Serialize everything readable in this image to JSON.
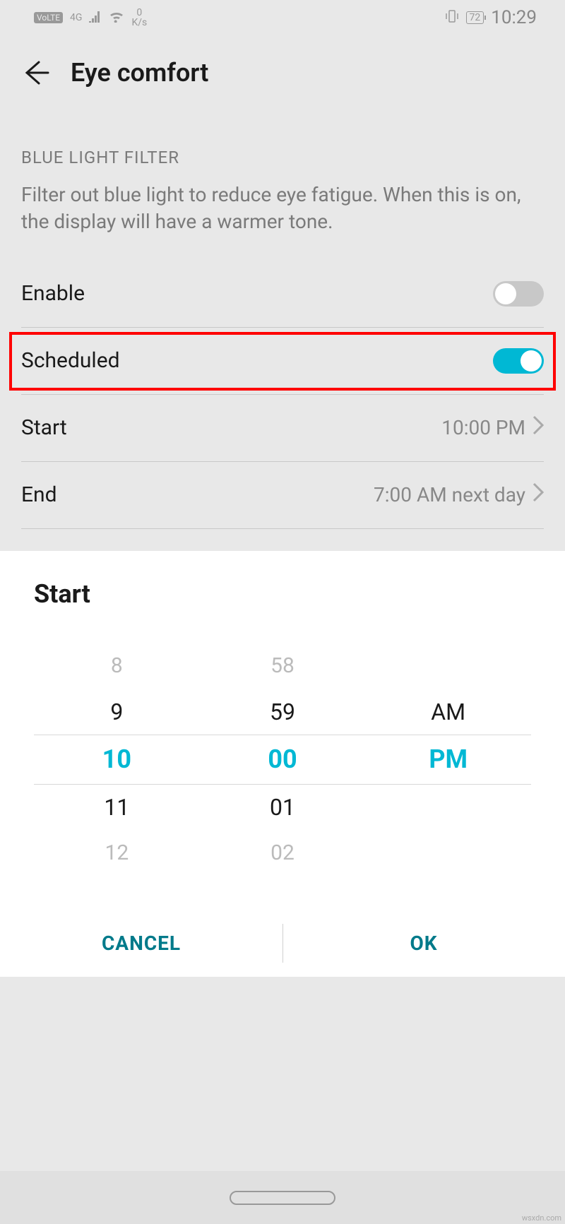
{
  "statusbar": {
    "volte": "VoLTE",
    "network": "4G",
    "speed_value": "0",
    "speed_unit": "K/s",
    "battery": "72",
    "time": "10:29"
  },
  "header": {
    "title": "Eye comfort"
  },
  "section": {
    "label": "BLUE LIGHT FILTER",
    "description": "Filter out blue light to reduce eye fatigue. When this is on, the display will have a warmer tone."
  },
  "settings": {
    "enable_label": "Enable",
    "scheduled_label": "Scheduled",
    "start_label": "Start",
    "start_value": "10:00 PM",
    "end_label": "End",
    "end_value": "7:00 AM next day"
  },
  "picker": {
    "title": "Start",
    "hours": [
      "8",
      "9",
      "10",
      "11",
      "12"
    ],
    "minutes": [
      "58",
      "59",
      "00",
      "01",
      "02"
    ],
    "ampm": [
      "AM",
      "PM"
    ],
    "cancel": "CANCEL",
    "ok": "OK"
  },
  "watermark": "wsxdn.com"
}
